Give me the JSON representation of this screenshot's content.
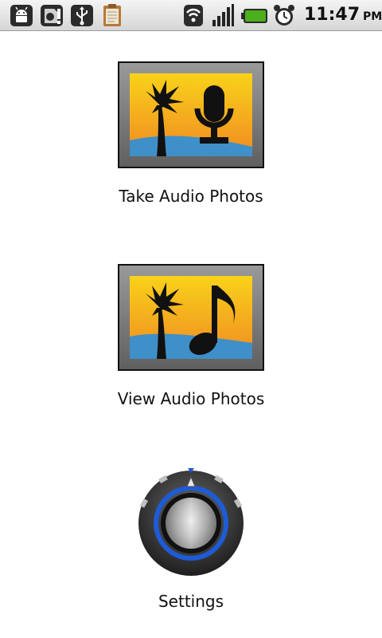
{
  "status_bar": {
    "icons": [
      "android-debug-icon",
      "sd-card-warning-icon",
      "usb-icon",
      "clipboard-icon",
      "wifi-icon",
      "signal-icon",
      "battery-icon",
      "alarm-clock-icon"
    ],
    "time": "11:47",
    "ampm": "PM",
    "battery_color": "#4caf1e"
  },
  "menu": {
    "items": [
      {
        "label": "Take Audio Photos",
        "icon": "palm-microphone-icon"
      },
      {
        "label": "View Audio Photos",
        "icon": "palm-music-note-icon"
      },
      {
        "label": "Settings",
        "icon": "settings-knob-icon"
      }
    ]
  },
  "colors": {
    "sky_top": "#f9d21a",
    "sky_bottom": "#f08a22",
    "water": "#3f8fc9",
    "frame": "#7a7a7a",
    "knob_ring": "#1e5bd6"
  }
}
